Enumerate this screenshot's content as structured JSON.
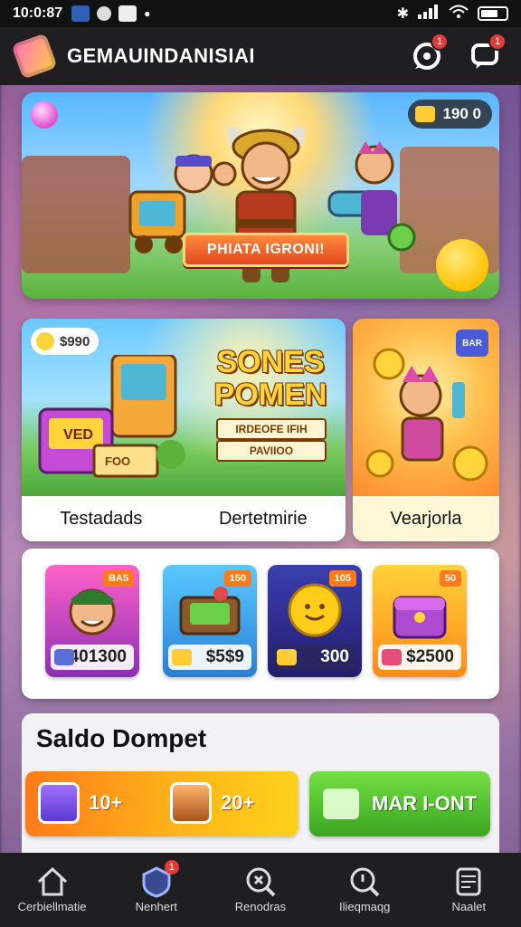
{
  "status_bar": {
    "time": "10:0:87"
  },
  "header": {
    "title": "GEMAUINDANISIAI",
    "notif_badge": "1",
    "chat_badge": "1"
  },
  "hero": {
    "coins": "190 0",
    "cta": "PHIATA IGRONI!"
  },
  "promo_left": {
    "chip": "$990",
    "title_line1": "SONES",
    "title_line2": "POMEN",
    "sub1": "IRDEOFE IFIH",
    "sub2": "PAVIIOO",
    "tablet_label": "VED",
    "sign_label": "FOO",
    "caption_left": "Testadads",
    "caption_right": "Dertetmirie"
  },
  "promo_right": {
    "screen": "BAR",
    "caption": "Vearjorla"
  },
  "shop": {
    "items": [
      {
        "tag": "BA5",
        "price": "401300",
        "color1": "#ff62c8",
        "color2": "#8b2fb4"
      },
      {
        "tag": "150",
        "price": "$5$9",
        "color1": "#59c9ff",
        "color2": "#2a7fd4"
      },
      {
        "tag": "105",
        "price": "300",
        "color1": "#3a3fb0",
        "color2": "#241c6e"
      },
      {
        "tag": "50",
        "price": "$2500",
        "color1": "#ffd23a",
        "color2": "#ff8a1a"
      }
    ]
  },
  "wallet": {
    "title": "Saldo Dompet",
    "value1": "10+",
    "value2": "20+",
    "button": "MAR I-ONT"
  },
  "nav": {
    "items": [
      {
        "label": "Cerbiellmatie",
        "icon": "home-icon"
      },
      {
        "label": "Nenhert",
        "icon": "shield-icon",
        "badge": "1"
      },
      {
        "label": "Renodras",
        "icon": "search-icon"
      },
      {
        "label": "Ilieqmaqg",
        "icon": "magnifier-icon"
      },
      {
        "label": "Naalet",
        "icon": "wallet-icon"
      }
    ]
  },
  "colors": {
    "accent": "#ff7a1a",
    "nav_bg": "#1f1f21",
    "badge": "#e53935"
  }
}
